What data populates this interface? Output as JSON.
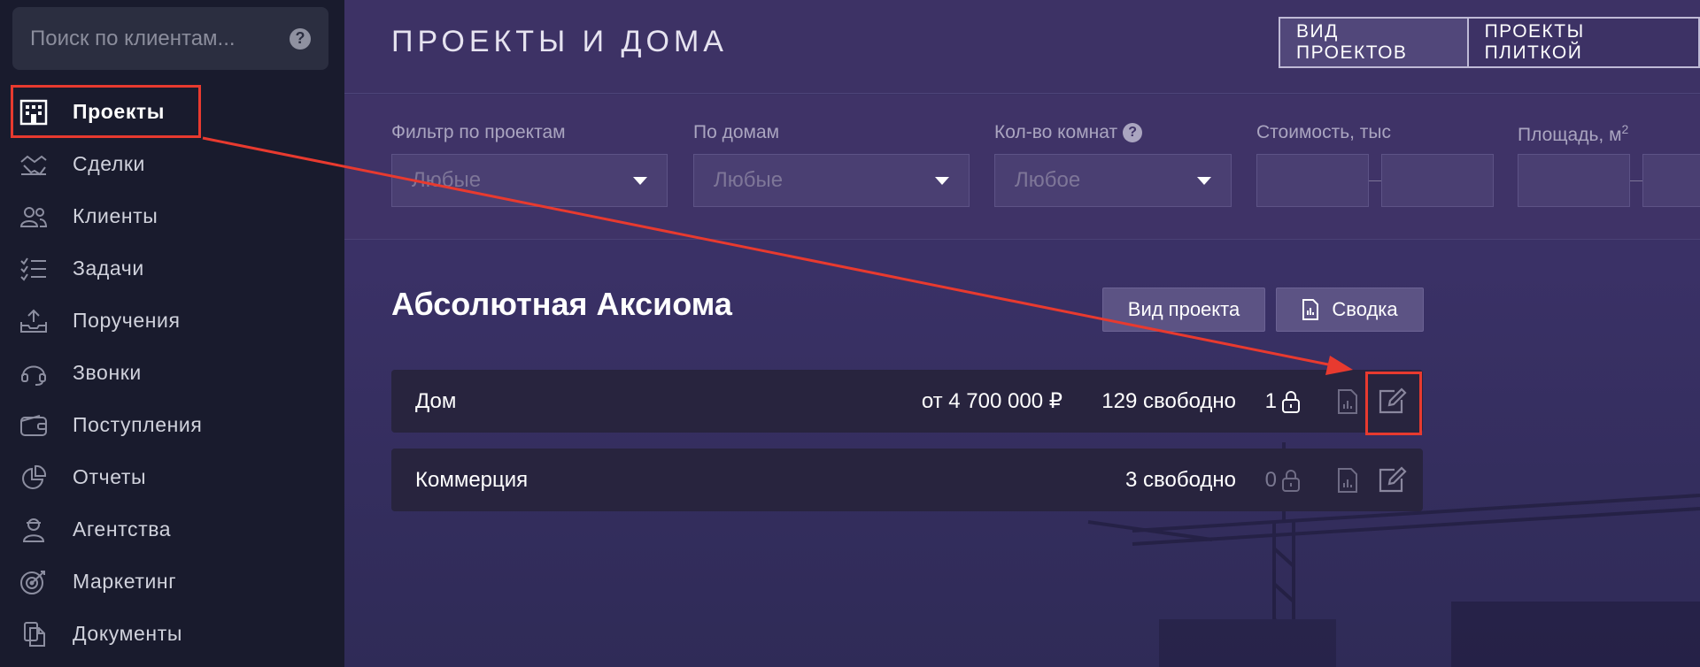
{
  "search": {
    "placeholder": "Поиск по клиентам..."
  },
  "sidebar": {
    "items": [
      {
        "label": "Проекты",
        "icon": "building-icon"
      },
      {
        "label": "Сделки",
        "icon": "handshake-icon"
      },
      {
        "label": "Клиенты",
        "icon": "users-icon"
      },
      {
        "label": "Задачи",
        "icon": "checklist-icon"
      },
      {
        "label": "Поручения",
        "icon": "inbox-upload-icon"
      },
      {
        "label": "Звонки",
        "icon": "headset-icon"
      },
      {
        "label": "Поступления",
        "icon": "wallet-icon"
      },
      {
        "label": "Отчеты",
        "icon": "pie-chart-icon"
      },
      {
        "label": "Агентства",
        "icon": "agent-icon"
      },
      {
        "label": "Маркетинг",
        "icon": "target-icon"
      },
      {
        "label": "Документы",
        "icon": "documents-icon"
      }
    ]
  },
  "header": {
    "title": "ПРОЕКТЫ И ДОМА",
    "view_projects": "ВИД ПРОЕКТОВ",
    "projects_tiles": "ПРОЕКТЫ ПЛИТКОЙ"
  },
  "filters": {
    "by_project": {
      "label": "Фильтр по проектам",
      "value": "Любые"
    },
    "by_house": {
      "label": "По домам",
      "value": "Любые"
    },
    "rooms": {
      "label": "Кол-во комнат",
      "value": "Любое"
    },
    "cost": {
      "label": "Стоимость, тыс"
    },
    "area": {
      "label": "Площадь, м",
      "sup": "2"
    }
  },
  "project": {
    "title": "Абсолютная Аксиома",
    "view_btn": "Вид проекта",
    "summary_btn": "Сводка",
    "rows": [
      {
        "name": "Дом",
        "price": "от 4 700 000 ₽",
        "free": "129 свободно",
        "count": "1"
      },
      {
        "name": "Коммерция",
        "price": "",
        "free": "3 свободно",
        "count": "0"
      }
    ]
  },
  "colors": {
    "accent_red": "#e83a2f",
    "sidebar_bg": "#191b2d",
    "main_bg": "#3b3163"
  }
}
